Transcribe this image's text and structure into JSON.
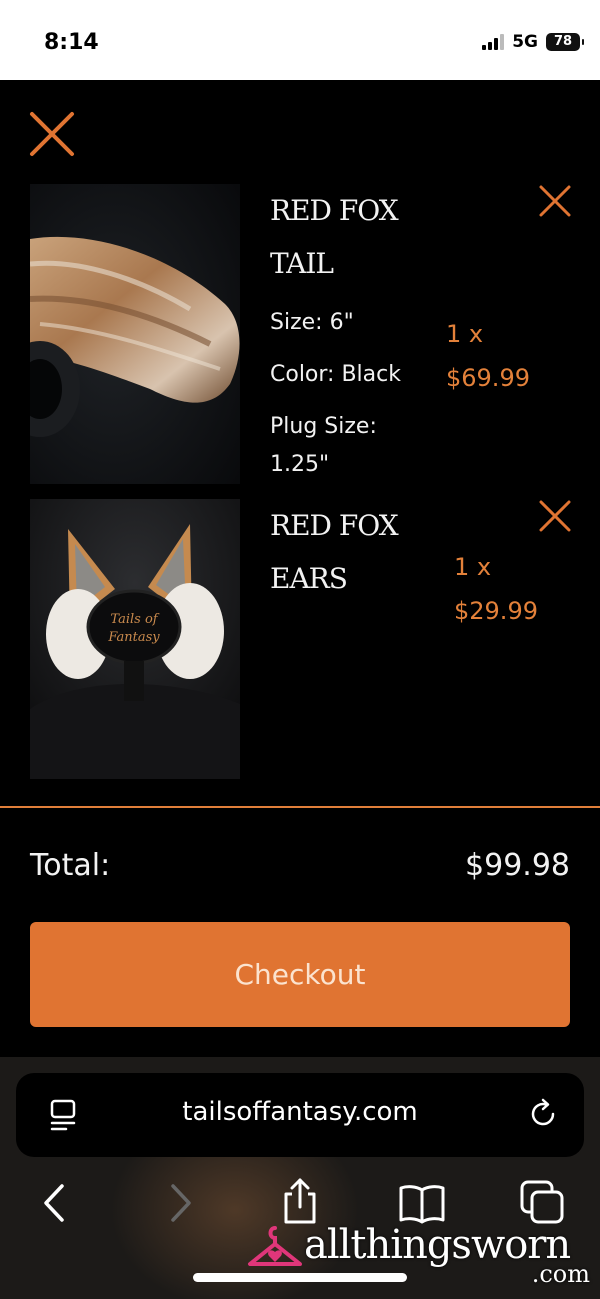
{
  "status_bar": {
    "time": "8:14",
    "network": "5G",
    "battery": "78"
  },
  "cart": {
    "items": [
      {
        "title_line1": "RED FOX",
        "title_line2": "TAIL",
        "options": [
          "Size: 6\"",
          "Color: Black",
          "Plug Size:",
          "1.25\""
        ],
        "qty": "1 x",
        "price": "$69.99"
      },
      {
        "title_line1": "RED FOX",
        "title_line2": "EARS",
        "qty": "1 x",
        "price": "$29.99",
        "logo_text_1": "Tails of",
        "logo_text_2": "Fantasy"
      }
    ],
    "total_label": "Total:",
    "total_value": "$99.98",
    "checkout_label": "Checkout"
  },
  "browser": {
    "url": "tailsoffantasy.com"
  },
  "watermark": {
    "text": "allthingsworn",
    "suffix": ".com"
  },
  "colors": {
    "accent": "#e07432",
    "price": "#e3813a",
    "background": "#000000"
  }
}
